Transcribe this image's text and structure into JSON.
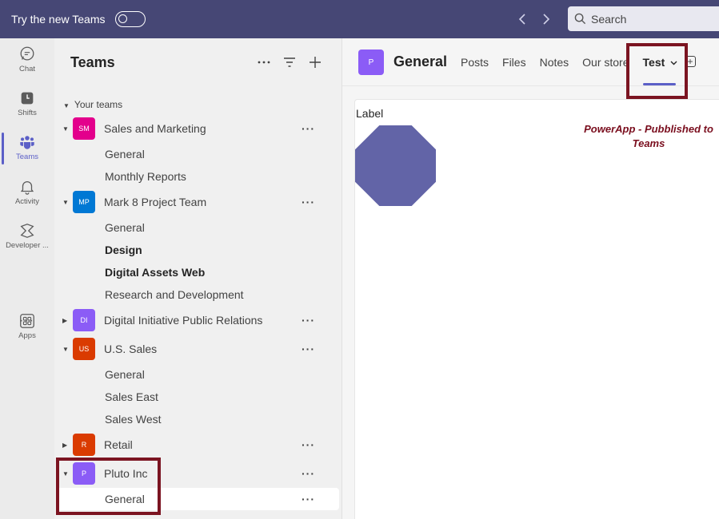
{
  "topbar": {
    "try_label": "Try the new Teams",
    "search_placeholder": "Search"
  },
  "rail": {
    "items": [
      {
        "label": "Chat",
        "icon": "chat-icon"
      },
      {
        "label": "Shifts",
        "icon": "shifts-icon"
      },
      {
        "label": "Teams",
        "icon": "teams-icon"
      },
      {
        "label": "Activity",
        "icon": "bell-icon"
      },
      {
        "label": "Developer ...",
        "icon": "developer-icon"
      },
      {
        "label": "Apps",
        "icon": "apps-icon"
      }
    ],
    "more": "···"
  },
  "panel": {
    "title": "Teams",
    "section_label": "Your teams",
    "teams": [
      {
        "initials": "SM",
        "name": "Sales and Marketing",
        "color": "#e3008c",
        "channels": [
          "General",
          "Monthly Reports"
        ]
      },
      {
        "initials": "MP",
        "name": "Mark 8 Project Team",
        "color": "#0078d4",
        "channels": [
          "General",
          "Design",
          "Digital Assets Web",
          "Research and Development"
        ]
      },
      {
        "initials": "DI",
        "name": "Digital Initiative Public Relations",
        "color": "#8b5cf6",
        "channels": []
      },
      {
        "initials": "US",
        "name": "U.S. Sales",
        "color": "#da3b01",
        "channels": [
          "General",
          "Sales East",
          "Sales West"
        ]
      },
      {
        "initials": "R",
        "name": "Retail",
        "color": "#da3b01",
        "channels": []
      },
      {
        "initials": "P",
        "name": "Pluto Inc",
        "color": "#8b5cf6",
        "channels": [
          "General"
        ]
      }
    ],
    "more_dots": "···"
  },
  "main": {
    "avatar": "P",
    "channel_title": "General",
    "tabs": [
      "Posts",
      "Files",
      "Notes",
      "Our store",
      "Test"
    ],
    "canvas_label": "Label",
    "powerapp_line1": "PowerApp - Pubblished to",
    "powerapp_line2": "Teams"
  },
  "colors": {
    "topbar": "#464775",
    "accent": "#5b5fc7",
    "octagon": "#6264a7",
    "highlight": "#7b1421"
  }
}
